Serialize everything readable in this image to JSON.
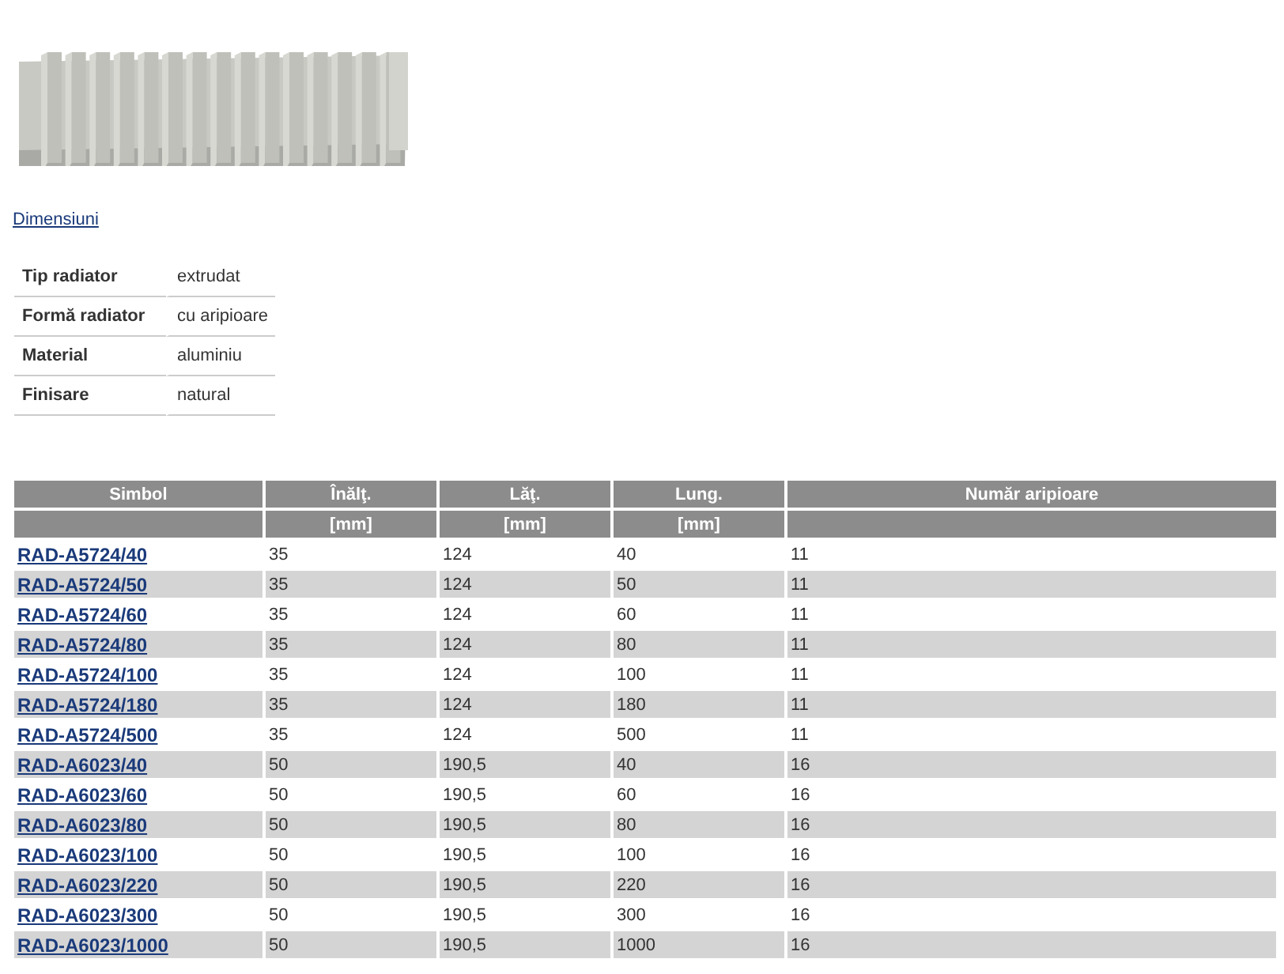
{
  "dimensions_link": "Dimensiuni",
  "specs": [
    {
      "label": "Tip radiator",
      "value": "extrudat"
    },
    {
      "label": "Formă radiator",
      "value": "cu aripioare"
    },
    {
      "label": "Material",
      "value": "aluminiu"
    },
    {
      "label": "Finisare",
      "value": "natural"
    }
  ],
  "table": {
    "columns": [
      {
        "title": "Simbol"
      },
      {
        "title": "Înălţ.",
        "unit": "[mm]"
      },
      {
        "title": "Lăţ.",
        "unit": "[mm]"
      },
      {
        "title": "Lung.",
        "unit": "[mm]"
      },
      {
        "title": "Număr aripioare"
      }
    ],
    "rows": [
      [
        "RAD-A5724/40",
        "35",
        "124",
        "40",
        "11"
      ],
      [
        "RAD-A5724/50",
        "35",
        "124",
        "50",
        "11"
      ],
      [
        "RAD-A5724/60",
        "35",
        "124",
        "60",
        "11"
      ],
      [
        "RAD-A5724/80",
        "35",
        "124",
        "80",
        "11"
      ],
      [
        "RAD-A5724/100",
        "35",
        "124",
        "100",
        "11"
      ],
      [
        "RAD-A5724/180",
        "35",
        "124",
        "180",
        "11"
      ],
      [
        "RAD-A5724/500",
        "35",
        "124",
        "500",
        "11"
      ],
      [
        "RAD-A6023/40",
        "50",
        "190,5",
        "40",
        "16"
      ],
      [
        "RAD-A6023/60",
        "50",
        "190,5",
        "60",
        "16"
      ],
      [
        "RAD-A6023/80",
        "50",
        "190,5",
        "80",
        "16"
      ],
      [
        "RAD-A6023/100",
        "50",
        "190,5",
        "100",
        "16"
      ],
      [
        "RAD-A6023/220",
        "50",
        "190,5",
        "220",
        "16"
      ],
      [
        "RAD-A6023/300",
        "50",
        "190,5",
        "300",
        "16"
      ],
      [
        "RAD-A6023/1000",
        "50",
        "190,5",
        "1000",
        "16"
      ]
    ]
  }
}
